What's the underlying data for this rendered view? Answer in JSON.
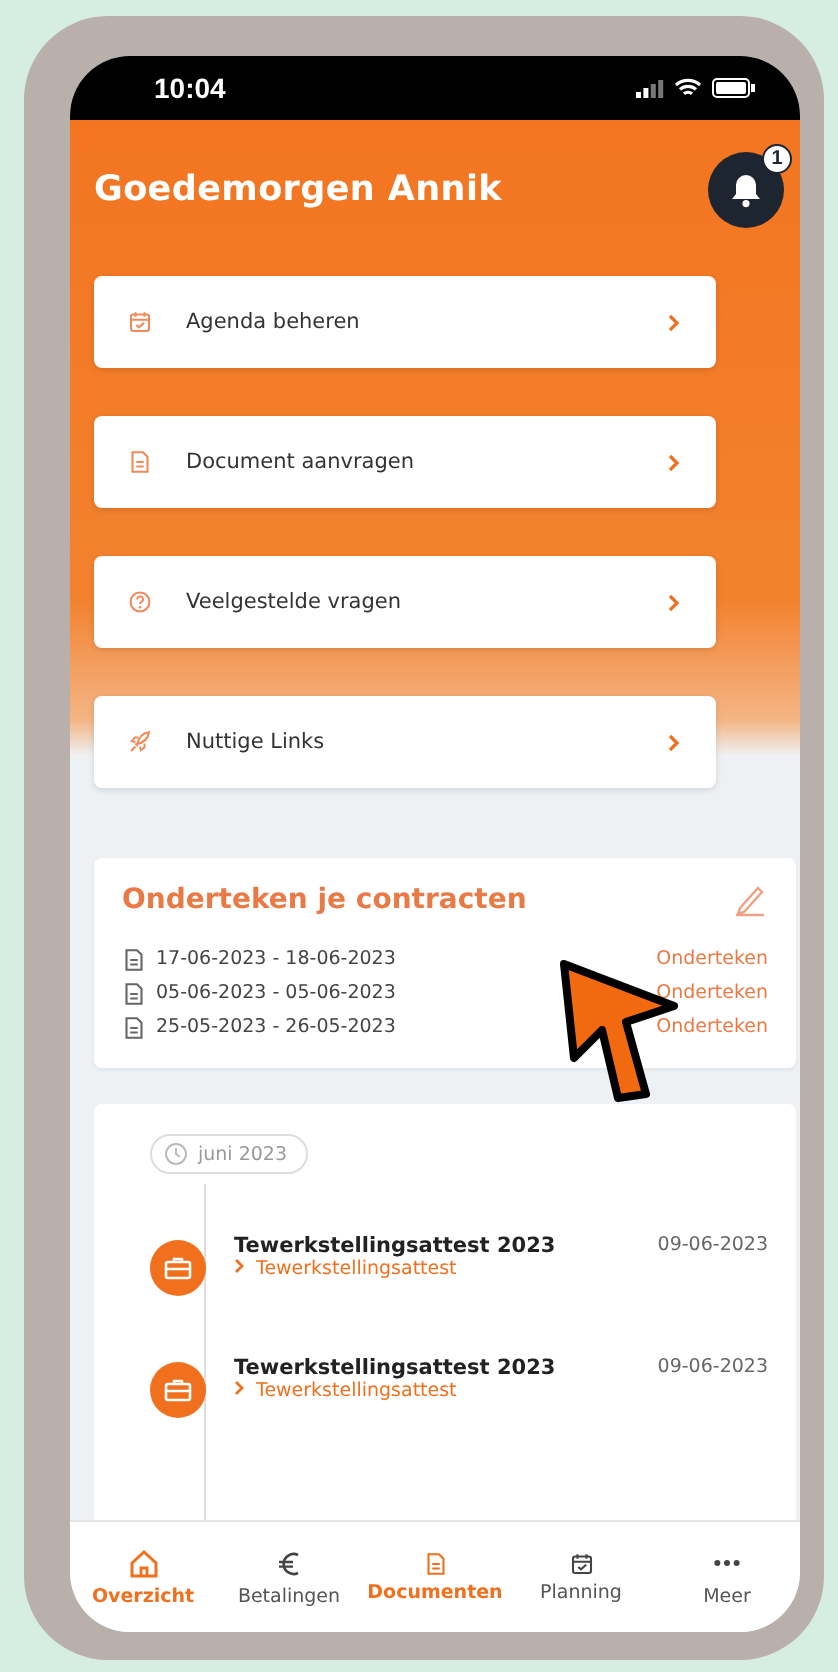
{
  "status_bar": {
    "time": "10:04"
  },
  "header": {
    "greeting": "Goedemorgen Annik",
    "notification_count": "1"
  },
  "menu": [
    {
      "label": "Agenda beheren",
      "kind": "calendar"
    },
    {
      "label": "Document aanvragen",
      "kind": "document"
    },
    {
      "label": "Veelgestelde vragen",
      "kind": "question"
    },
    {
      "label": "Nuttige Links",
      "kind": "rocket"
    }
  ],
  "contracts": {
    "title": "Onderteken je contracten",
    "items": [
      {
        "period": "17-06-2023 - 18-06-2023",
        "action": "Onderteken"
      },
      {
        "period": "05-06-2023 - 05-06-2023",
        "action": "Onderteken"
      },
      {
        "period": "25-05-2023 - 26-05-2023",
        "action": "Onderteken"
      }
    ]
  },
  "timeline": {
    "month": "juni 2023",
    "entries": [
      {
        "title": "Tewerkstellingsattest 2023",
        "link": "Tewerkstellingsattest",
        "date": "09-06-2023"
      },
      {
        "title": "Tewerkstellingsattest 2023",
        "link": "Tewerkstellingsattest",
        "date": "09-06-2023"
      }
    ]
  },
  "tabs": [
    {
      "label": "Overzicht",
      "kind": "home",
      "selected": true
    },
    {
      "label": "Betalingen",
      "kind": "euro",
      "selected": false
    },
    {
      "label": "Documenten",
      "kind": "document",
      "selected": true
    },
    {
      "label": "Planning",
      "kind": "calendar",
      "selected": false
    },
    {
      "label": "Meer",
      "kind": "more",
      "selected": false
    }
  ]
}
